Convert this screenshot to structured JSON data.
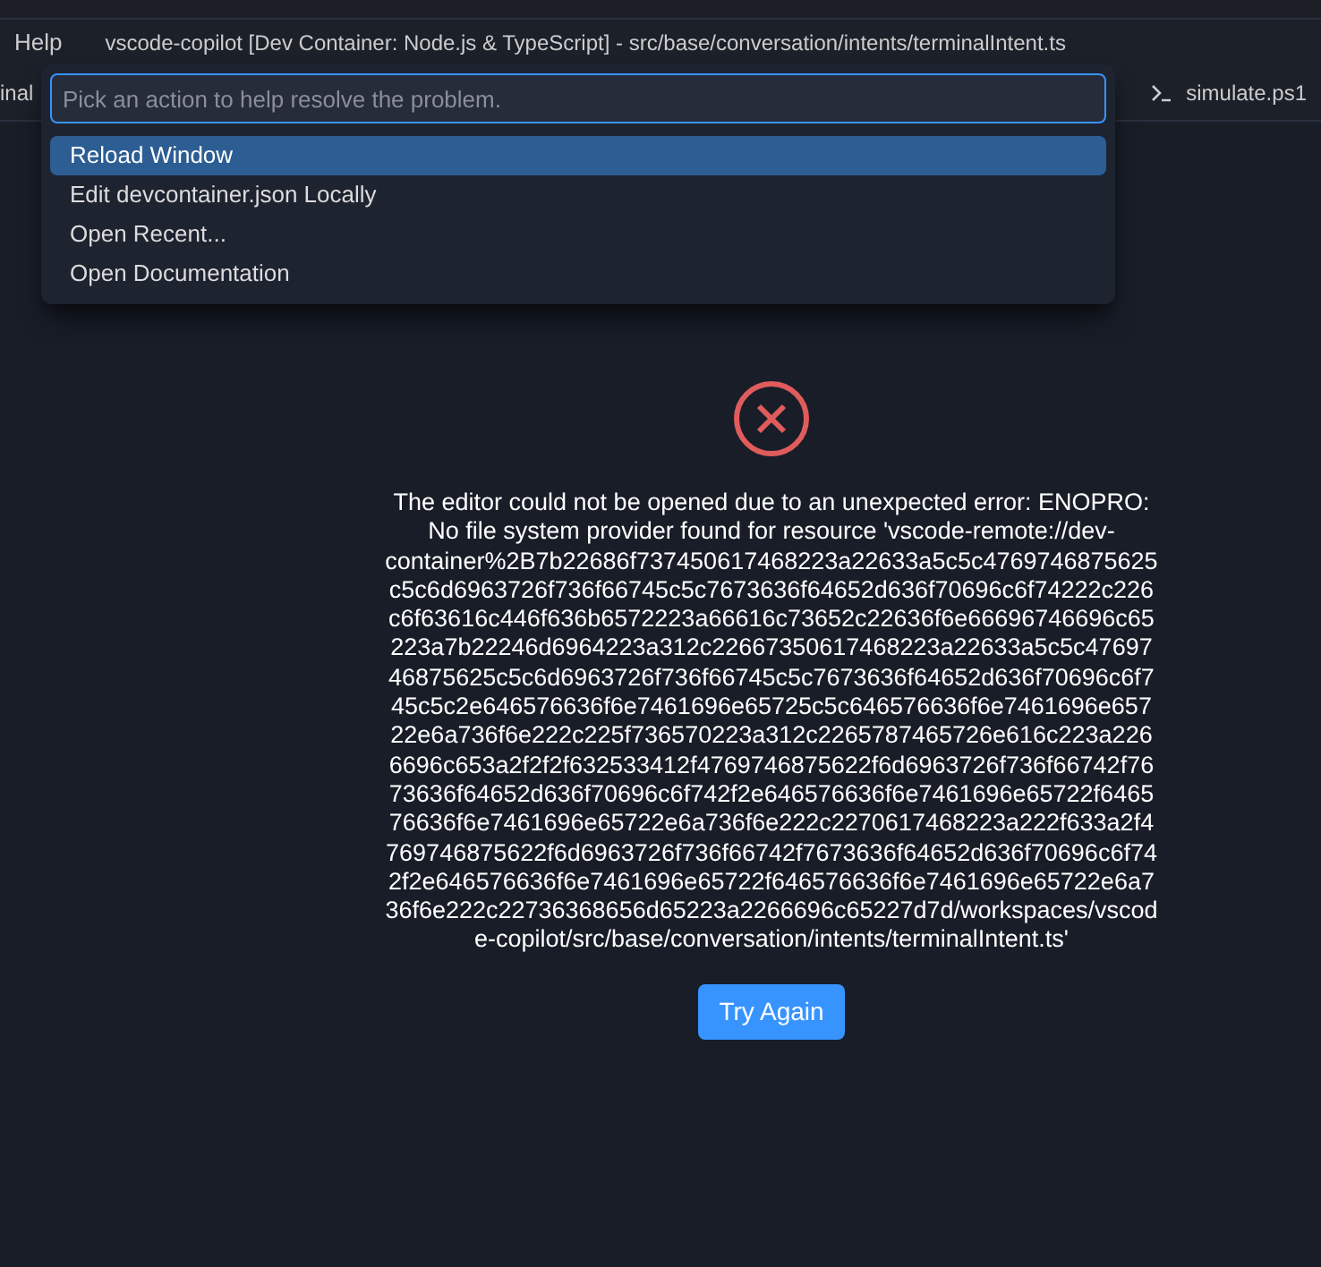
{
  "menu": [
    "Help"
  ],
  "window": {
    "title": "vscode-copilot [Dev Container: Node.js & TypeScript] - src/base/conversation/intents/terminalIntent.ts"
  },
  "tabs": [
    {
      "label": "inal",
      "kind": "plain"
    },
    {
      "label": "simulate.ps1",
      "kind": "terminal"
    }
  ],
  "quick_pick": {
    "placeholder": "Pick an action to help resolve the problem.",
    "items": [
      {
        "label": "Reload Window",
        "selected": true
      },
      {
        "label": "Edit devcontainer.json Locally",
        "selected": false
      },
      {
        "label": "Open Recent...",
        "selected": false
      },
      {
        "label": "Open Documentation",
        "selected": false
      }
    ]
  },
  "error": {
    "message": "The editor could not be opened due to an unexpected error: ENOPRO: No file system provider found for resource 'vscode-remote://dev-container%2B7b22686f737450617468223a22633a5c5c4769746875625c5c6d6963726f736f66745c5c7673636f64652d636f70696c6f74222c226c6f63616c446f636b6572223a66616c73652c22636f6e66696746696c65223a7b22246d6964223a312c22667350617468223a22633a5c5c4769746875625c5c6d6963726f736f66745c5c7673636f64652d636f70696c6f745c5c2e646576636f6e7461696e65725c5c646576636f6e7461696e65722e6a736f6e222c225f736570223a312c2265787465726e616c223a2266696c653a2f2f2f632533412f4769746875622f6d6963726f736f66742f7673636f64652d636f70696c6f742f2e646576636f6e7461696e65722f646576636f6e7461696e65722e6a736f6e222c2270617468223a222f633a2f4769746875622f6d6963726f736f66742f7673636f64652d636f70696c6f742f2e646576636f6e7461696e65722f646576636f6e7461696e65722e6a736f6e222c22736368656d65223a2266696c65227d7d/workspaces/vscode-copilot/src/base/conversation/intents/terminalIntent.ts'",
    "button": "Try Again"
  }
}
